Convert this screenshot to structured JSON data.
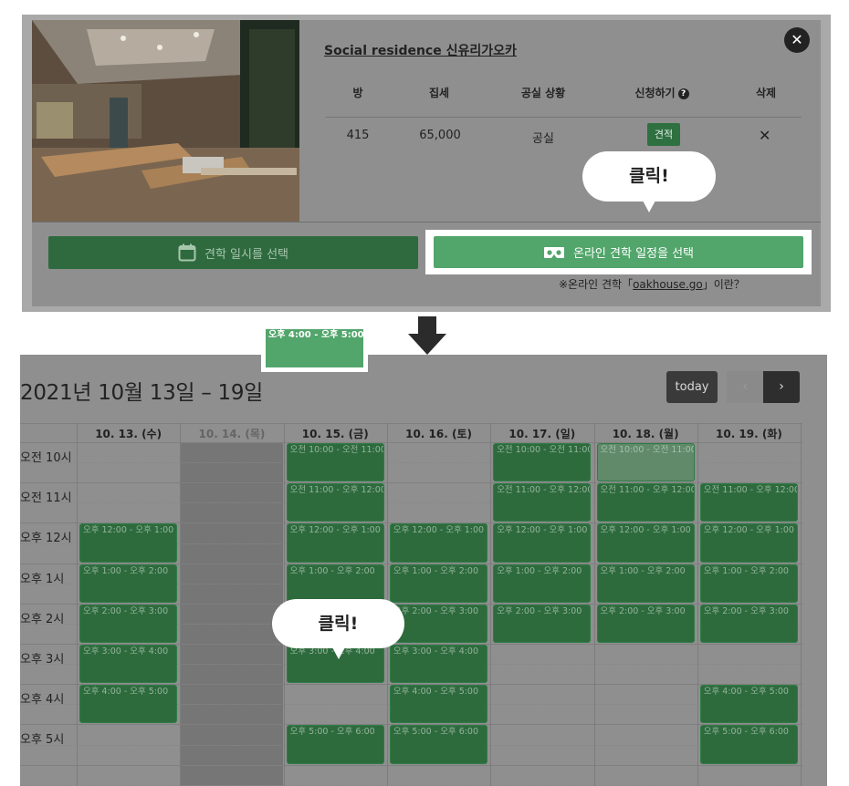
{
  "modal": {
    "residence_name": "Social residence 신유리가오카",
    "close_symbol": "✕",
    "table": {
      "headers": [
        "방",
        "집세",
        "공실 상황",
        "신청하기",
        "삭제"
      ],
      "help_symbol": "?",
      "row": {
        "room": "415",
        "rent": "65,000",
        "status": "공실",
        "apply_button": "견적",
        "delete_symbol": "✕"
      }
    },
    "date_button": "견학 일시를 선택",
    "online_button": "온라인 견학 일정을 선택",
    "online_note_prefix": "※온라인 견학「",
    "online_note_link": "oakhouse.go",
    "online_note_suffix": "」이란？",
    "click_bubble": "클릭!"
  },
  "calendar": {
    "title": "2021년 10월 13일 – 19일",
    "today_button": "today",
    "prev_symbol": "‹",
    "next_symbol": "›",
    "days": [
      "10. 13. (수)",
      "10. 14. (목)",
      "10. 15. (금)",
      "10. 16. (토)",
      "10. 17. (일)",
      "10. 18. (월)",
      "10. 19. (화)"
    ],
    "hours": [
      "오전 10시",
      "오전 11시",
      "오후 12시",
      "오후 1시",
      "오후 2시",
      "오후 3시",
      "오후 4시",
      "오후 5시"
    ],
    "slot_labels": [
      "오전 10:00 - 오전 11:00",
      "오전 11:00 - 오후 12:00",
      "오후 12:00 - 오후 1:00",
      "오후 1:00 - 오후 2:00",
      "오후 2:00 - 오후 3:00",
      "오후 3:00 - 오후 4:00",
      "오후 4:00 - 오후 5:00",
      "오후 5:00 - 오후 6:00"
    ],
    "available": [
      [
        2,
        3,
        4,
        5,
        6
      ],
      [],
      [
        0,
        1,
        2,
        3,
        4,
        5,
        6,
        7
      ],
      [
        2,
        3,
        4,
        5,
        6,
        7
      ],
      [
        0,
        1,
        2,
        3,
        4
      ],
      [
        0,
        1,
        2,
        3,
        4
      ],
      [
        1,
        2,
        3,
        4,
        6,
        7
      ]
    ],
    "faded_slots": [
      [
        5,
        0
      ]
    ],
    "selected_slot": {
      "day_index": 2,
      "slot_index": 6,
      "label": "오후 4:00 - 오후 5:00"
    },
    "click_bubble": "클릭!"
  },
  "colors": {
    "accent_green": "#52a56b",
    "dim_green": "#2d6b3d",
    "overlay_gray": "#8f8f8f"
  }
}
